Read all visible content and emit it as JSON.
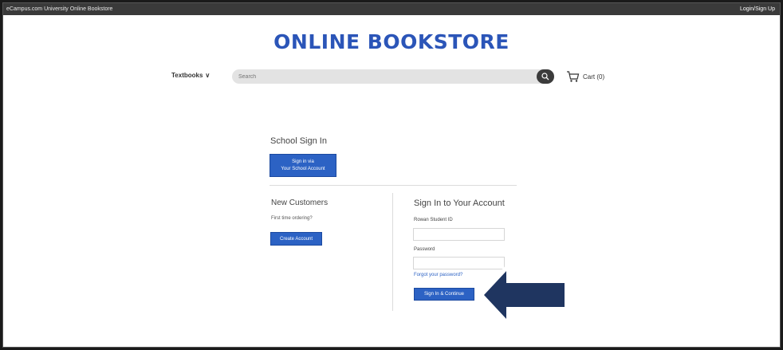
{
  "topbar": {
    "site_title": "eCampus.com University Online Bookstore",
    "login_label": "Login/Sign Up"
  },
  "header": {
    "store_title": "ONLINE BOOKSTORE"
  },
  "nav": {
    "textbooks_label": "Textbooks",
    "search_placeholder": "Search",
    "cart_label": "Cart (0)"
  },
  "school_signin": {
    "title": "School Sign In",
    "button_line1": "Sign in via",
    "button_line2": "Your School Account"
  },
  "new_customers": {
    "title": "New Customers",
    "prompt": "First time ordering?",
    "button_label": "Create Account"
  },
  "account_signin": {
    "title": "Sign In to Your Account",
    "student_id_label": "Rowan Student ID",
    "student_id_value": "",
    "password_label": "Password",
    "password_value": "",
    "forgot_label": "Forgot your password?",
    "button_label": "Sign In & Continue"
  },
  "colors": {
    "brand": "#2b55b8",
    "button": "#2c62c4",
    "arrow_fill": "#1f3560",
    "topbar": "#3a3a3a"
  },
  "icons": {
    "search": "search-icon",
    "cart": "cart-icon",
    "chevron": "chevron-down-icon",
    "arrow": "arrow-left-icon"
  }
}
